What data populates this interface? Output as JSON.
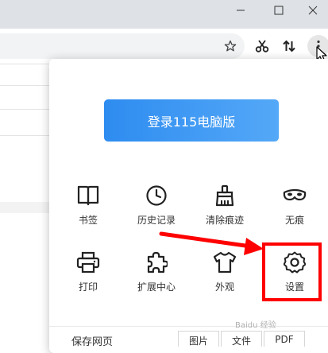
{
  "menu": {
    "login_label": "登录115电脑版",
    "grid": [
      {
        "label": "书签",
        "icon": "book-icon"
      },
      {
        "label": "历史记录",
        "icon": "clock-icon"
      },
      {
        "label": "清除痕迹",
        "icon": "broom-icon"
      },
      {
        "label": "无痕",
        "icon": "mask-icon"
      },
      {
        "label": "打印",
        "icon": "printer-icon"
      },
      {
        "label": "扩展中心",
        "icon": "puzzle-icon"
      },
      {
        "label": "外观",
        "icon": "shirt-icon"
      },
      {
        "label": "设置",
        "icon": "gear-icon"
      }
    ],
    "save_page_label": "保存网页",
    "save_options": [
      "图片",
      "文件",
      "PDF"
    ]
  },
  "watermark": "Baidu 经验",
  "colors": {
    "login_gradient_start": "#2e8cf0",
    "login_gradient_end": "#54a8f7",
    "highlight": "#ff0000"
  }
}
